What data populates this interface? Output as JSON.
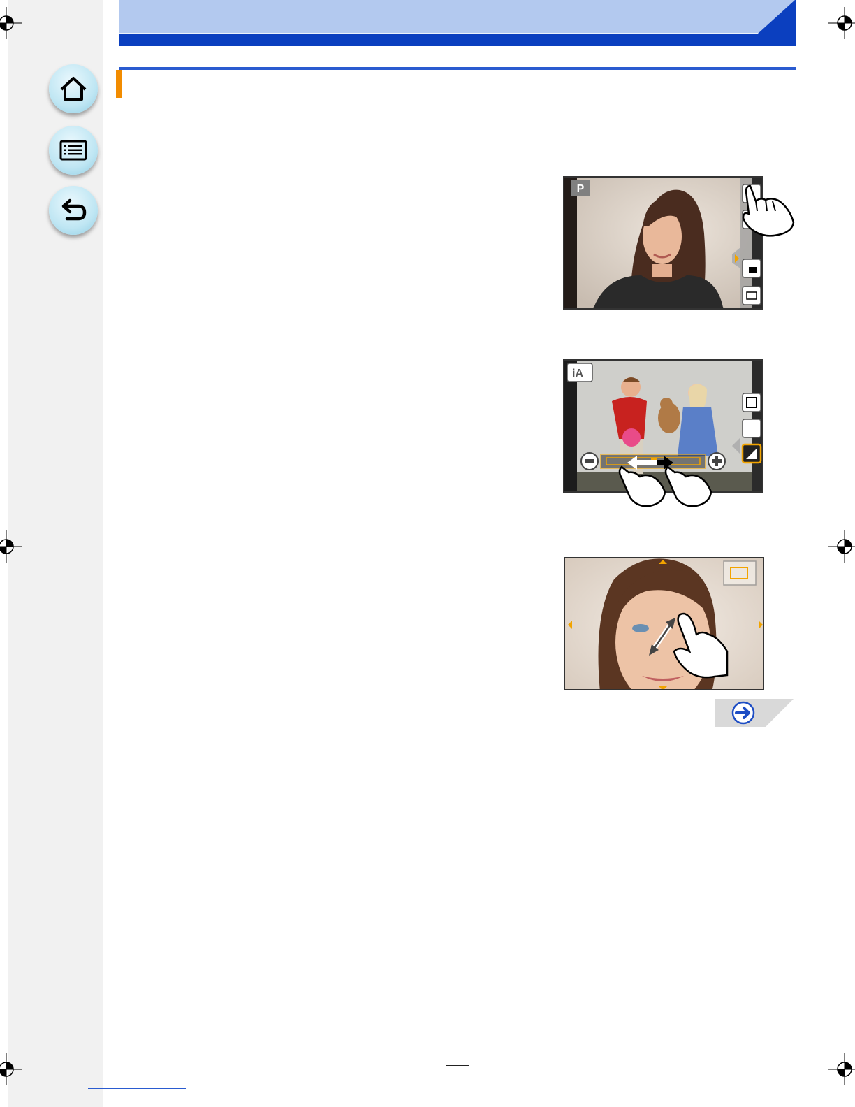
{
  "nav": {
    "home": {
      "icon": "home-icon"
    },
    "contents": {
      "icon": "list-icon"
    },
    "back": {
      "icon": "back-arrow-icon"
    }
  },
  "colors": {
    "header_light": "#b3c9ef",
    "header_dark": "#0b3fbf",
    "rule_blue": "#2a5bd0",
    "accent_orange": "#f28c00",
    "sidebar_gray": "#f1f1f1"
  },
  "screens": [
    {
      "name": "touch-zoom-screen",
      "mode_badge": "P"
    },
    {
      "name": "exposure-slider-screen",
      "mode_badge": "iA"
    },
    {
      "name": "pinch-zoom-screen"
    }
  ],
  "next_page": {
    "icon": "arrow-right-icon"
  }
}
